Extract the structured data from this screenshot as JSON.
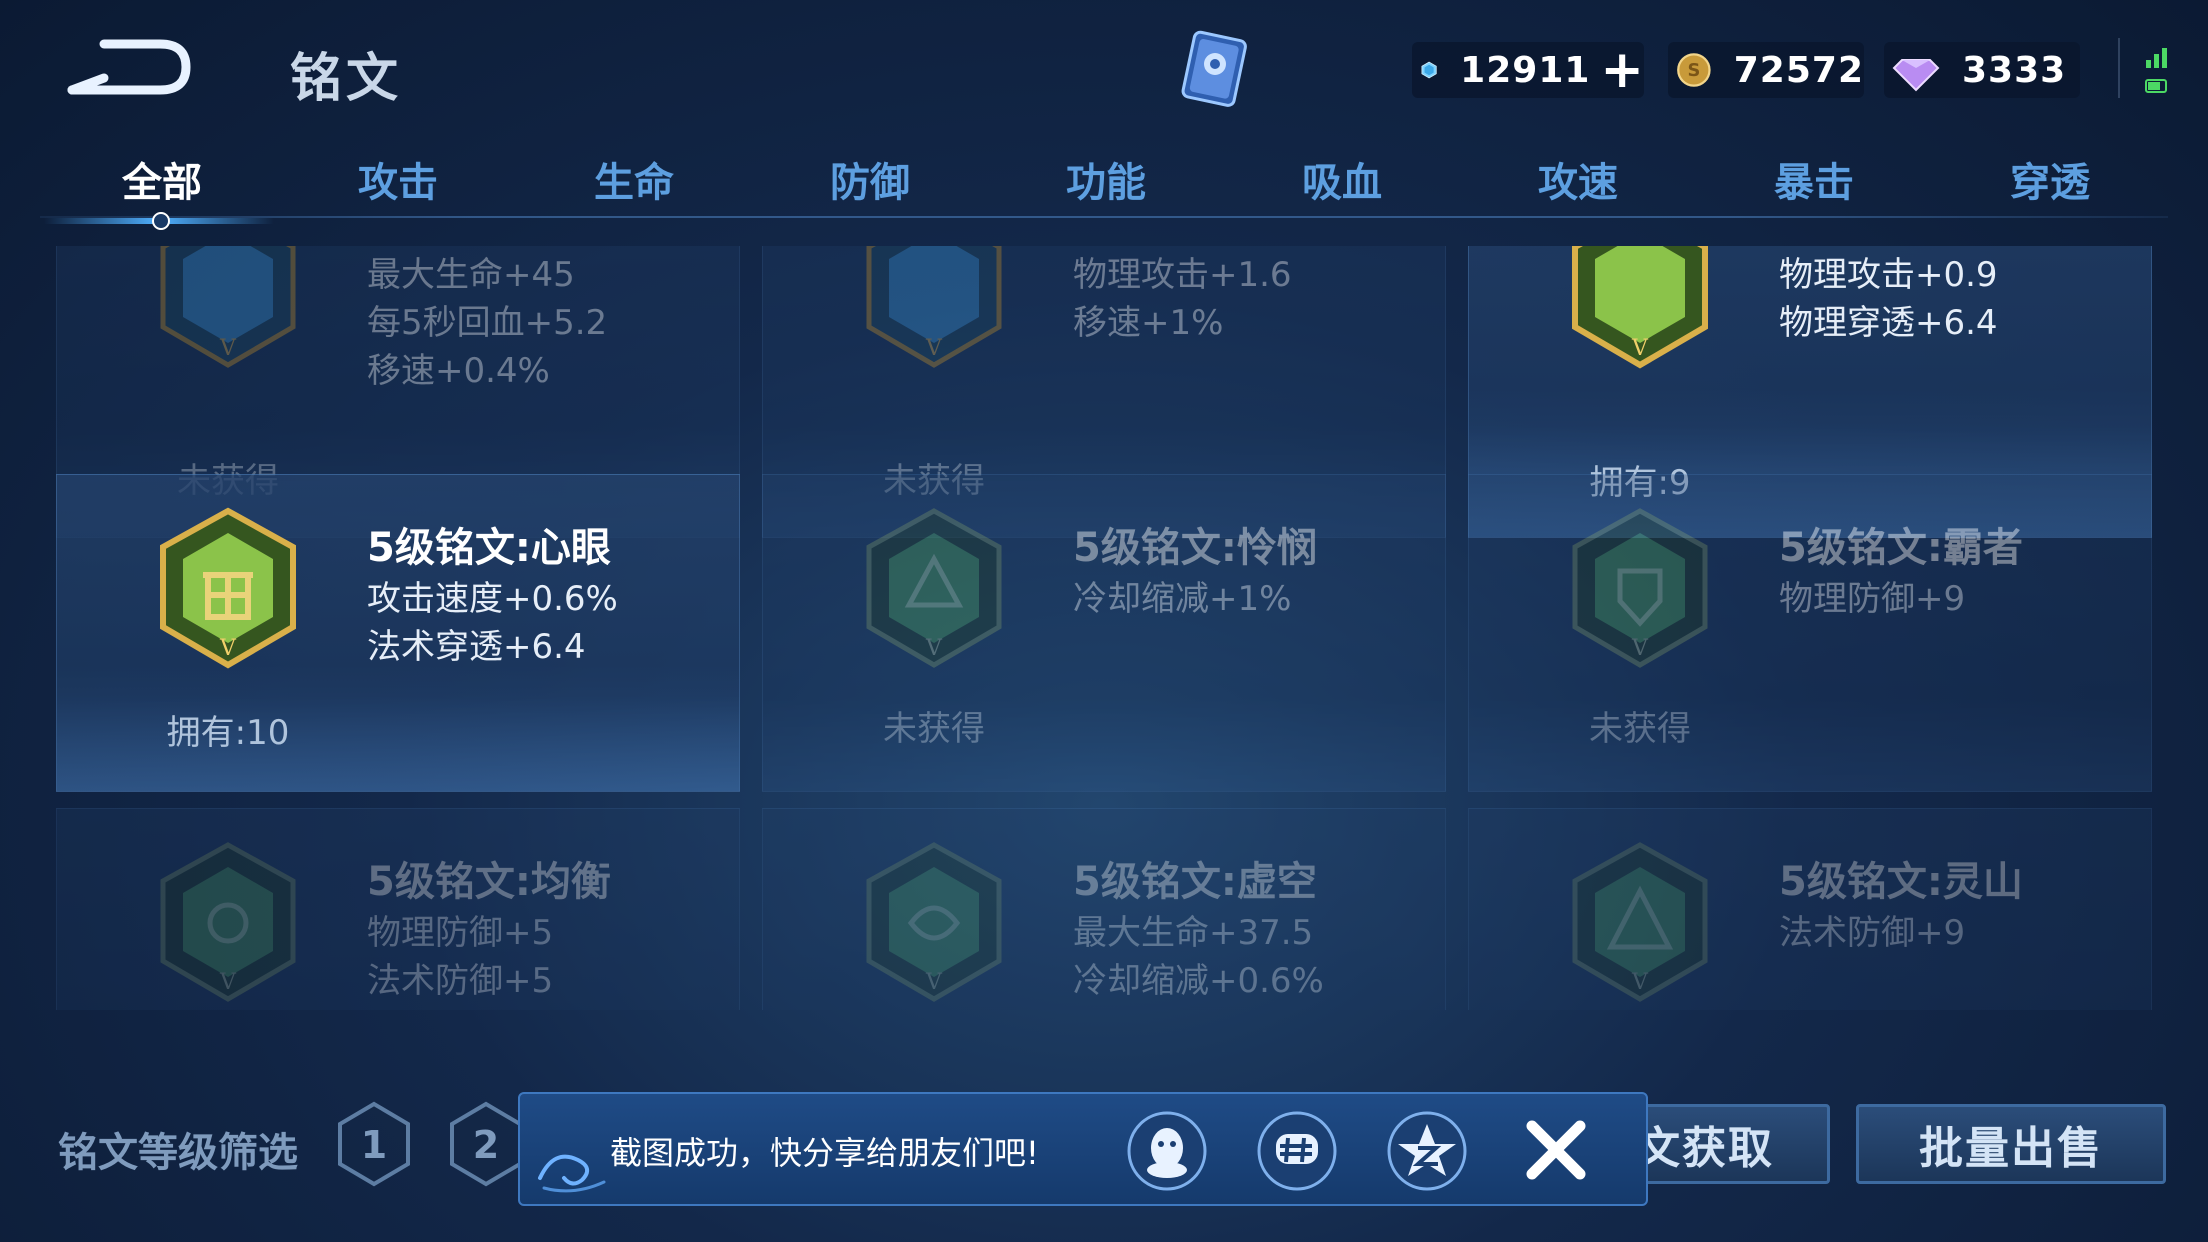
{
  "header": {
    "title": "铭文",
    "currencies": [
      {
        "name": "crystal",
        "icon": "crystal-icon",
        "value": "12911",
        "has_plus": true
      },
      {
        "name": "gold",
        "icon": "gold-coin-icon",
        "value": "72572"
      },
      {
        "name": "diamond",
        "icon": "diamond-icon",
        "value": "3333"
      }
    ]
  },
  "tabs": [
    {
      "label": "全部",
      "active": true
    },
    {
      "label": "攻击"
    },
    {
      "label": "生命"
    },
    {
      "label": "防御"
    },
    {
      "label": "功能"
    },
    {
      "label": "吸血"
    },
    {
      "label": "攻速"
    },
    {
      "label": "暴击"
    },
    {
      "label": "穿透"
    }
  ],
  "cards": [
    {
      "name": "",
      "attrs": [
        "最大生命+45",
        "每5秒回血+5.2",
        "移速+0.4%"
      ],
      "status": "未获得",
      "owned": false,
      "color": "#3a8fd0"
    },
    {
      "name": "",
      "attrs": [
        "物理攻击+1.6",
        "移速+1%"
      ],
      "status": "未获得",
      "owned": false,
      "color": "#3a8fd0"
    },
    {
      "name": "",
      "attrs": [
        "物理攻击+0.9",
        "物理穿透+6.4"
      ],
      "status": "拥有:9",
      "owned": true,
      "color": "#8bc34a"
    },
    {
      "name": "5级铭文:心眼",
      "attrs": [
        "攻击速度+0.6%",
        "法术穿透+6.4"
      ],
      "status": "拥有:10",
      "owned": true,
      "color": "#8bc34a"
    },
    {
      "name": "5级铭文:怜悯",
      "attrs": [
        "冷却缩减+1%"
      ],
      "status": "未获得",
      "owned": false,
      "color": "#4a9a5e"
    },
    {
      "name": "5级铭文:霸者",
      "attrs": [
        "物理防御+9"
      ],
      "status": "未获得",
      "owned": false,
      "color": "#4a9a5e"
    },
    {
      "name": "5级铭文:均衡",
      "attrs": [
        "物理防御+5",
        "法术防御+5"
      ],
      "status": "",
      "owned": false,
      "color": "#4a9a5e"
    },
    {
      "name": "5级铭文:虚空",
      "attrs": [
        "最大生命+37.5",
        "冷却缩减+0.6%"
      ],
      "status": "",
      "owned": false,
      "color": "#4a9a5e"
    },
    {
      "name": "5级铭文:灵山",
      "attrs": [
        "法术防御+9"
      ],
      "status": "",
      "owned": false,
      "color": "#4a9a5e"
    }
  ],
  "bottom": {
    "filter_label": "铭文等级筛选",
    "levels": [
      "1",
      "2"
    ],
    "get_button": "文获取",
    "sell_button": "批量出售"
  },
  "toast": {
    "message": "截图成功，快分享给朋友们吧!",
    "share_targets": [
      "qq-icon",
      "wechat-moments-icon",
      "qzone-icon"
    ]
  },
  "colors": {
    "accent": "#4fb0ff",
    "tab_inactive": "#5d9fe0",
    "owned_green": "#8bc34a"
  }
}
